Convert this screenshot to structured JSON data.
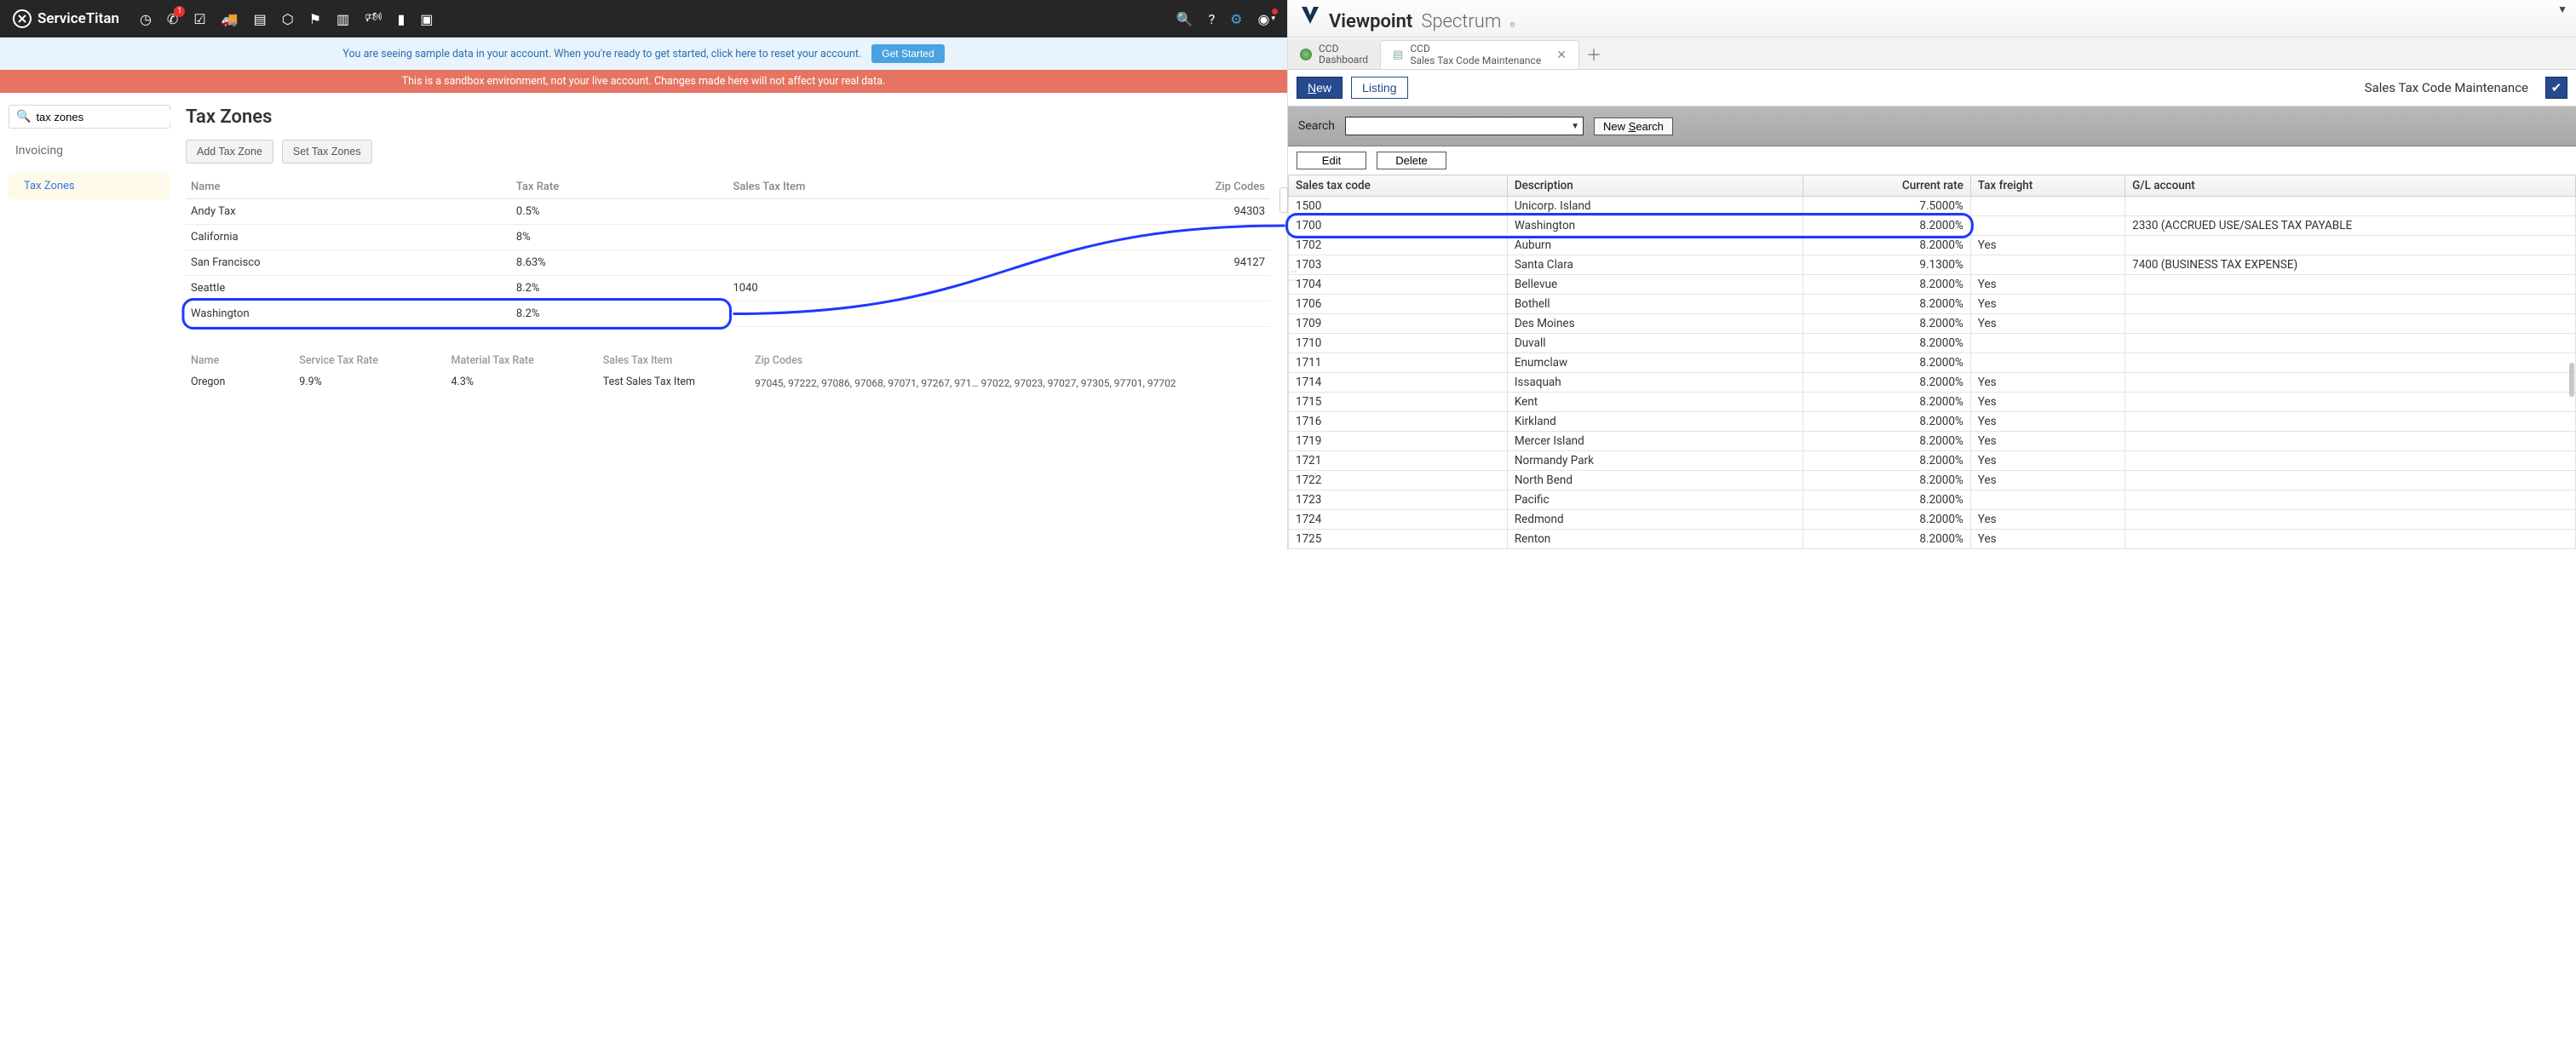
{
  "st": {
    "brand": "ServiceTitan",
    "icons": [
      "clock",
      "phone",
      "calendar-check",
      "truck",
      "clipboard",
      "box",
      "flag",
      "chart",
      "megaphone",
      "page",
      "folders",
      "search",
      "help",
      "gear",
      "avatar"
    ],
    "phoneBadge": "1",
    "banner1_text": "You are seeing sample data in your account. When you're ready to get started, click here to reset your account.",
    "banner1_btn": "Get Started",
    "banner2_text": "This is a sandbox environment, not your live account. Changes made here will not affect your real data.",
    "search_value": "tax zones",
    "side_heading": "Invoicing",
    "side_item": "Tax Zones",
    "title": "Tax Zones",
    "add_btn": "Add Tax Zone",
    "set_btn": "Set Tax Zones",
    "cols": {
      "name": "Name",
      "rate": "Tax Rate",
      "item": "Sales Tax Item",
      "zips": "Zip Codes"
    },
    "rows": [
      {
        "name": "Andy Tax",
        "rate": "0.5%",
        "item": "",
        "zips": "94303"
      },
      {
        "name": "California",
        "rate": "8%",
        "item": "",
        "zips": ""
      },
      {
        "name": "San Francisco",
        "rate": "8.63%",
        "item": "",
        "zips": "94127"
      },
      {
        "name": "Seattle",
        "rate": "8.2%",
        "item": "1040",
        "zips": ""
      },
      {
        "name": "Washington",
        "rate": "8.2%",
        "item": "",
        "zips": ""
      }
    ],
    "sub_cols": {
      "name": "Name",
      "srate": "Service Tax Rate",
      "mrate": "Material Tax Rate",
      "sitem": "Sales Tax Item",
      "zips": "Zip Codes"
    },
    "sub_row": {
      "name": "Oregon",
      "srate": "9.9%",
      "mrate": "4.3%",
      "sitem": "Test Sales Tax Item",
      "zips": "97045, 97222, 97086, 97068, 97071, 97267, 971… 97022, 97023, 97027, 97305, 97701, 97702"
    }
  },
  "vp": {
    "brand_main": "Viewpoint",
    "brand_sub": "Spectrum",
    "tab1_top": "CCD",
    "tab1_bot": "Dashboard",
    "tab2_top": "CCD",
    "tab2_bot": "Sales Tax Code Maintenance",
    "new_label": "ew",
    "new_prefix": "N",
    "listing_label": "Listing",
    "toolbar_title": "Sales Tax Code Maintenance",
    "search_label": "Search",
    "newsearch_prefix": "New ",
    "newsearch_u": "S",
    "newsearch_suffix": "earch",
    "edit_label": "Edit",
    "delete_label": "Delete",
    "grid_cols": {
      "code": "Sales tax code",
      "desc": "Description",
      "rate": "Current rate",
      "freight": "Tax freight",
      "gl": "G/L account"
    },
    "grid_rows": [
      {
        "code": "1500",
        "desc": "Unicorp. Island",
        "rate": "7.5000%",
        "freight": "",
        "gl": ""
      },
      {
        "code": "1700",
        "desc": "Washington",
        "rate": "8.2000%",
        "freight": "",
        "gl": "2330 (ACCRUED USE/SALES TAX PAYABLE"
      },
      {
        "code": "1702",
        "desc": "Auburn",
        "rate": "8.2000%",
        "freight": "Yes",
        "gl": ""
      },
      {
        "code": "1703",
        "desc": "Santa Clara",
        "rate": "9.1300%",
        "freight": "",
        "gl": "7400 (BUSINESS TAX EXPENSE)"
      },
      {
        "code": "1704",
        "desc": "Bellevue",
        "rate": "8.2000%",
        "freight": "Yes",
        "gl": ""
      },
      {
        "code": "1706",
        "desc": "Bothell",
        "rate": "8.2000%",
        "freight": "Yes",
        "gl": ""
      },
      {
        "code": "1709",
        "desc": "Des Moines",
        "rate": "8.2000%",
        "freight": "Yes",
        "gl": ""
      },
      {
        "code": "1710",
        "desc": "Duvall",
        "rate": "8.2000%",
        "freight": "",
        "gl": ""
      },
      {
        "code": "1711",
        "desc": "Enumclaw",
        "rate": "8.2000%",
        "freight": "",
        "gl": ""
      },
      {
        "code": "1714",
        "desc": "Issaquah",
        "rate": "8.2000%",
        "freight": "Yes",
        "gl": ""
      },
      {
        "code": "1715",
        "desc": "Kent",
        "rate": "8.2000%",
        "freight": "Yes",
        "gl": ""
      },
      {
        "code": "1716",
        "desc": "Kirkland",
        "rate": "8.2000%",
        "freight": "Yes",
        "gl": ""
      },
      {
        "code": "1719",
        "desc": "Mercer Island",
        "rate": "8.2000%",
        "freight": "Yes",
        "gl": ""
      },
      {
        "code": "1721",
        "desc": "Normandy Park",
        "rate": "8.2000%",
        "freight": "Yes",
        "gl": ""
      },
      {
        "code": "1722",
        "desc": "North Bend",
        "rate": "8.2000%",
        "freight": "Yes",
        "gl": ""
      },
      {
        "code": "1723",
        "desc": "Pacific",
        "rate": "8.2000%",
        "freight": "",
        "gl": ""
      },
      {
        "code": "1724",
        "desc": "Redmond",
        "rate": "8.2000%",
        "freight": "Yes",
        "gl": ""
      },
      {
        "code": "1725",
        "desc": "Renton",
        "rate": "8.2000%",
        "freight": "Yes",
        "gl": ""
      }
    ]
  }
}
